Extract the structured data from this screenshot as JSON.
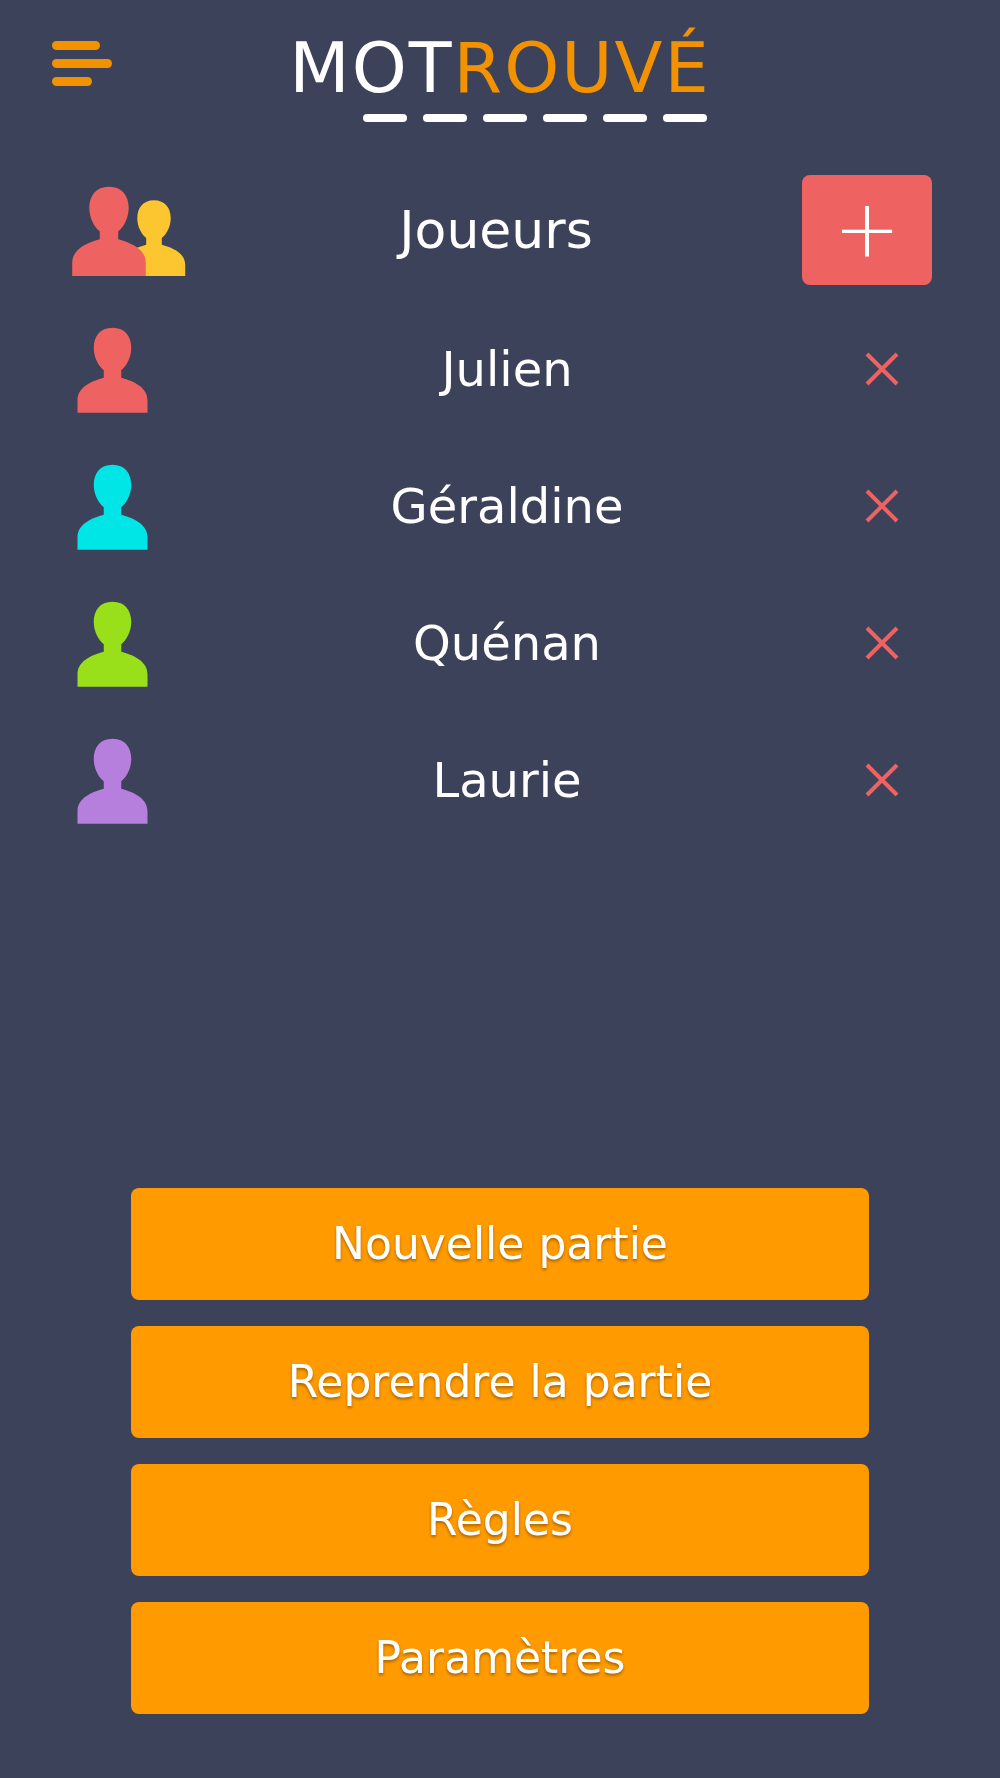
{
  "logo": {
    "plain": "MOT",
    "accent": "ROUVÉ"
  },
  "players_header": {
    "title": "Joueurs",
    "add_button": "+"
  },
  "players": [
    {
      "name": "Julien",
      "color": "#ee6362"
    },
    {
      "name": "Géraldine",
      "color": "#00e5e5"
    },
    {
      "name": "Quénan",
      "color": "#99e01b"
    },
    {
      "name": "Laurie",
      "color": "#b77fdd"
    }
  ],
  "menu_buttons": [
    "Nouvelle partie",
    "Reprendre la partie",
    "Règles",
    "Paramètres"
  ]
}
